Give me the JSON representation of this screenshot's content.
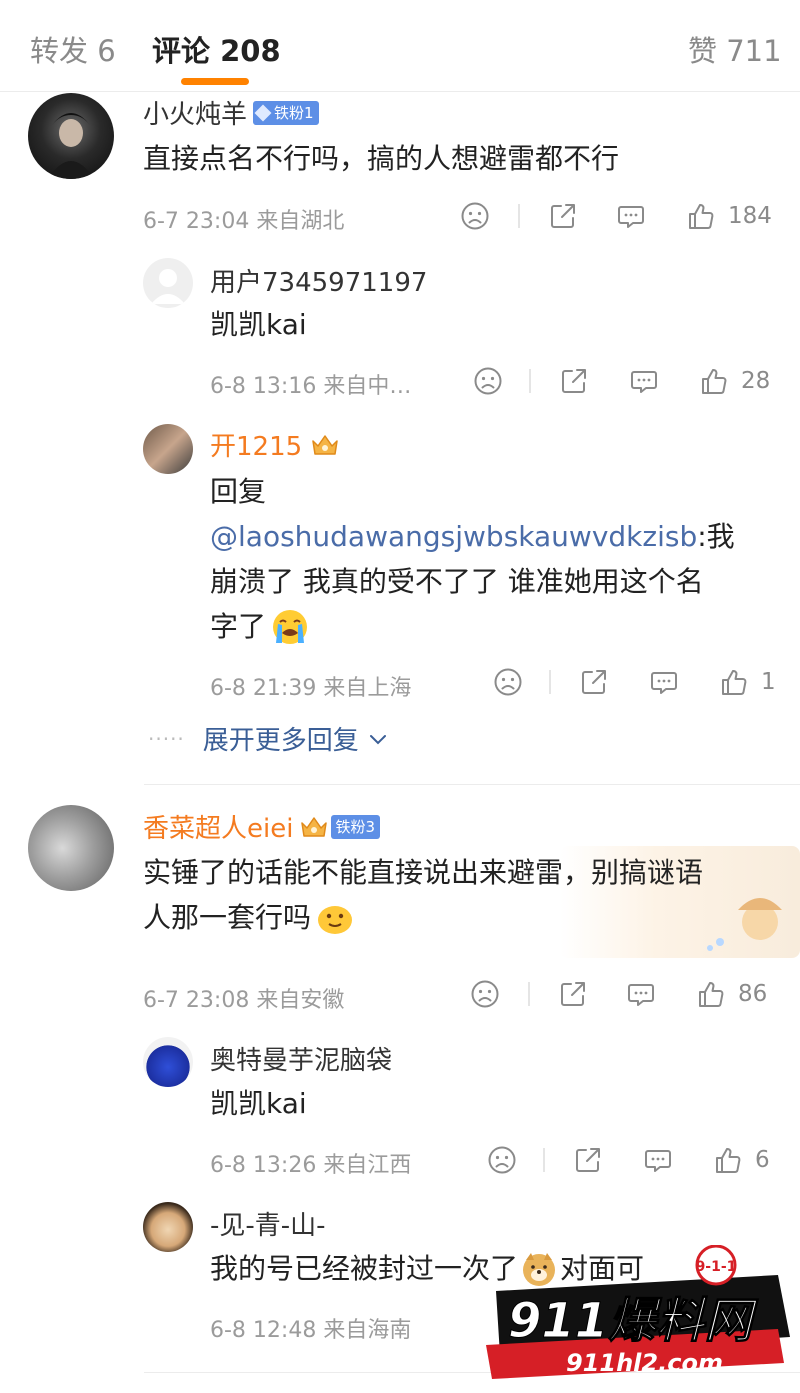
{
  "tabs": {
    "repost": "转发 6",
    "comments": "评论 208",
    "likes": "赞 711"
  },
  "comments": [
    {
      "name": "小火炖羊",
      "badge": "铁粉1",
      "text": "直接点名不行吗，搞的人想避雷都不行",
      "meta": "6-7 23:04 来自湖北",
      "likes": "184",
      "replies": [
        {
          "name": "用户7345971197",
          "text": "凯凯kai",
          "meta": "6-8 13:16 来自中…",
          "likes": "28"
        },
        {
          "name": "开1215",
          "text1": "回复",
          "mention": "@laoshudawangsjwbskauwvdkzisb",
          "text2": ":我",
          "text3": "崩溃了 我真的受不了了 谁准她用这个名",
          "text4": "字了",
          "meta": "6-8 21:39 来自上海",
          "likes": "1"
        }
      ],
      "expand": "展开更多回复"
    },
    {
      "name": "香菜超人eiei",
      "badge": "铁粉3",
      "text1": "实锤了的话能不能直接说出来避雷，别搞谜语",
      "text2": "人那一套行吗",
      "meta": "6-7 23:08 来自安徽",
      "likes": "86",
      "replies": [
        {
          "name": "奥特曼芋泥脑袋",
          "text": "凯凯kai",
          "meta": "6-8 13:26 来自江西",
          "likes": "6"
        },
        {
          "name": "-见-青-山-",
          "text1": "我的号已经被封过一次了",
          "text2": "对面可",
          "meta": "6-8 12:48 来自海南"
        }
      ]
    }
  ],
  "watermark": {
    "brand": "911爆料网",
    "url": "911hl2.com",
    "badge": "9-1-1"
  },
  "colors": {
    "accent": "#ff8200",
    "link": "#4a6ca8",
    "vip_name": "#f47b20",
    "badge": "#5d8fe6"
  }
}
